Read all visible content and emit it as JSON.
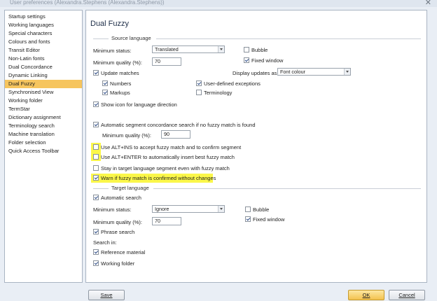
{
  "window": {
    "title": "User preferences (Alexandra.Stephens (Alexandra.Stephens))"
  },
  "sidebar": {
    "items": [
      {
        "label": "Startup settings"
      },
      {
        "label": "Working languages"
      },
      {
        "label": "Special characters"
      },
      {
        "label": "Colours and fonts"
      },
      {
        "label": "Transit Editor"
      },
      {
        "label": "Non-Latin fonts"
      },
      {
        "label": "Dual Concordance"
      },
      {
        "label": "Dynamic Linking"
      },
      {
        "label": "Dual Fuzzy",
        "selected": true
      },
      {
        "label": "Synchronised View"
      },
      {
        "label": "Working folder"
      },
      {
        "label": "TermStar"
      },
      {
        "label": "Dictionary assignment"
      },
      {
        "label": "Terminology search"
      },
      {
        "label": "Machine translation"
      },
      {
        "label": "Folder selection"
      },
      {
        "label": "Quick Access Toolbar"
      }
    ]
  },
  "main": {
    "title": "Dual Fuzzy",
    "source": {
      "section_label": "Source language",
      "min_status_label": "Minimum status:",
      "min_status_value": "Translated",
      "min_quality_label": "Minimum quality (%):",
      "min_quality_value": "70",
      "bubble_label": "Bubble",
      "bubble_checked": false,
      "fixed_window_label": "Fixed window",
      "fixed_window_checked": true,
      "update_matches_label": "Update matches",
      "update_matches_checked": true,
      "display_updates_label": "Display updates as",
      "display_updates_value": "Font colour",
      "numbers_label": "Numbers",
      "numbers_checked": true,
      "markups_label": "Markups",
      "markups_checked": true,
      "user_exceptions_label": "User-defined exceptions",
      "user_exceptions_checked": true,
      "terminology_label": "Terminology",
      "terminology_checked": false,
      "show_icon_label": "Show icon for language direction",
      "show_icon_checked": true,
      "auto_concordance_label": "Automatic segment concordance search if no fuzzy match is found",
      "auto_concordance_checked": true,
      "concordance_quality_label": "Minimum quality (%):",
      "concordance_quality_value": "90",
      "alt_ins_label": "Use ALT+INS to accept fuzzy match and to confirm segment",
      "alt_ins_checked": false,
      "alt_enter_label": "Use ALT+ENTER to automatically insert best fuzzy match",
      "alt_enter_checked": false,
      "stay_target_label": "Stay in target language segment even with fuzzy match",
      "stay_target_checked": false,
      "warn_label": "Warn if fuzzy match is confirmed without changes",
      "warn_checked": true
    },
    "target": {
      "section_label": "Target language",
      "auto_search_label": "Automatic search",
      "auto_search_checked": true,
      "min_status_label": "Minimum status:",
      "min_status_value": "Ignore",
      "min_quality_label": "Minimum quality (%):",
      "min_quality_value": "70",
      "bubble_label": "Bubble",
      "bubble_checked": false,
      "fixed_window_label": "Fixed window",
      "fixed_window_checked": true,
      "phrase_search_label": "Phrase search",
      "phrase_search_checked": true,
      "search_in_label": "Search in:",
      "reference_label": "Reference material",
      "reference_checked": true,
      "working_folder_label": "Working folder",
      "working_folder_checked": true
    }
  },
  "buttons": {
    "save": "Save",
    "ok": "OK",
    "cancel": "Cancel"
  },
  "colors": {
    "selection": "#f6c55e",
    "highlight": "#fbf74a",
    "check": "#2b4a86"
  }
}
